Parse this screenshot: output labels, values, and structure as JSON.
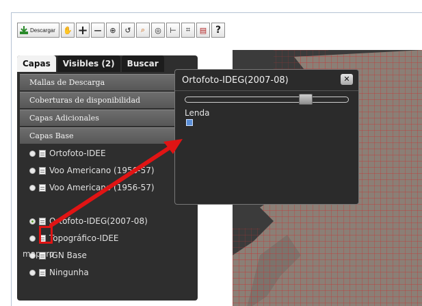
{
  "toolbar": {
    "download_label": "Descargar",
    "tools": [
      {
        "name": "pan-hand-icon",
        "glyph": "✋"
      },
      {
        "name": "zoom-in-icon",
        "glyph": "+"
      },
      {
        "name": "zoom-out-icon",
        "glyph": "—"
      },
      {
        "name": "zoom-box-icon",
        "glyph": "⊕"
      },
      {
        "name": "zoom-previous-icon",
        "glyph": "↺"
      },
      {
        "name": "zoom-extent-icon",
        "glyph": "⌕"
      },
      {
        "name": "globe-icon",
        "glyph": "◎"
      },
      {
        "name": "measure-icon",
        "glyph": "⊢"
      },
      {
        "name": "crop-icon",
        "glyph": "⌗"
      },
      {
        "name": "print-icon",
        "glyph": "▤"
      },
      {
        "name": "help-icon",
        "glyph": "?"
      }
    ]
  },
  "tabs": [
    {
      "label": "Capas",
      "active": true
    },
    {
      "label": "Visibles (2)",
      "active": false
    },
    {
      "label": "Buscar",
      "active": false
    }
  ],
  "sections": [
    "Mallas de Descarga",
    "Coberturas de disponibilidad",
    "Capas Adicionales",
    "Capas Base"
  ],
  "base_layers_top": [
    "Ortofoto-IDEE",
    "Voo Americano (1956-57)",
    "Voo Americano (1956-57)"
  ],
  "group_label": "mappro",
  "base_layers_bottom": [
    {
      "label": "Ortofoto-IDEG(2007-08)",
      "selected": true
    },
    {
      "label": "Topográfico-IDEE",
      "selected": false
    },
    {
      "label": "IGN Base",
      "selected": false
    },
    {
      "label": "Ningunha",
      "selected": false
    }
  ],
  "popup": {
    "title": "Ortofoto-IDEG(2007-08)",
    "close": "✕",
    "opacity": 0.76,
    "legend_label": "Lenda"
  },
  "colors": {
    "annotation_red": "#e01414",
    "panel_bg": "#2e2e2e",
    "grid_red": "#c83232",
    "land": "#8b7f76"
  }
}
